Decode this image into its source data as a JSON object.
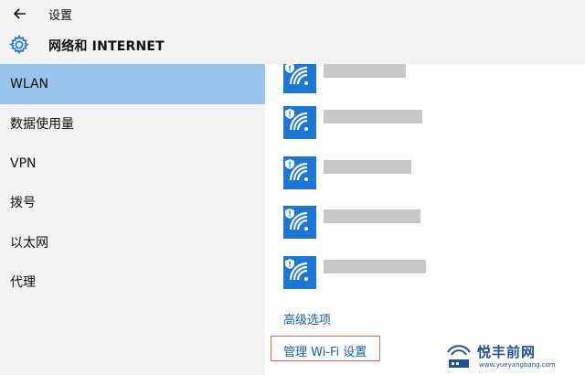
{
  "window": {
    "title": "设置",
    "back_icon": "arrow-left-icon"
  },
  "header": {
    "icon": "gear-icon",
    "title": "网络和 INTERNET"
  },
  "sidebar": {
    "items": [
      {
        "label": "WLAN",
        "selected": true
      },
      {
        "label": "数据使用量",
        "selected": false
      },
      {
        "label": "VPN",
        "selected": false
      },
      {
        "label": "拨号",
        "selected": false
      },
      {
        "label": "以太网",
        "selected": false
      },
      {
        "label": "代理",
        "selected": false
      }
    ]
  },
  "networks": [
    {
      "name": "",
      "icon": "wifi-secured-icon"
    },
    {
      "name": "",
      "icon": "wifi-secured-icon"
    },
    {
      "name": "",
      "icon": "wifi-secured-icon"
    },
    {
      "name": "",
      "icon": "wifi-secured-icon"
    },
    {
      "name": "",
      "icon": "wifi-secured-icon"
    }
  ],
  "links": {
    "advanced": "高级选项",
    "manage": "管理 Wi-Fi 设置"
  },
  "watermark": {
    "main": "悦丰前网",
    "url": "www.yueyangbang.com"
  },
  "colors": {
    "accent": "#1c78d4",
    "selected_bg": "#99c3ea",
    "link": "#1b5ea8",
    "highlight_box": "#e06060"
  }
}
